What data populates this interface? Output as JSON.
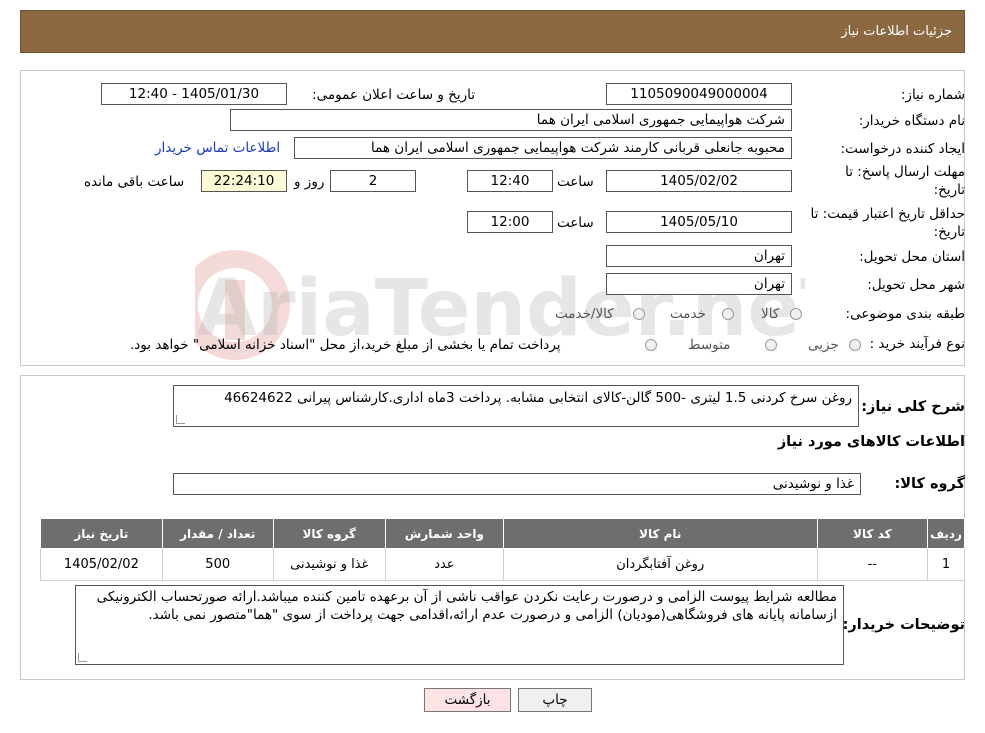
{
  "header": {
    "title": "جزئیات اطلاعات نیاز"
  },
  "form": {
    "need_number_label": "شماره نیاز:",
    "need_number": "1105090049000004",
    "announce_label": "تاریخ و ساعت اعلان عمومی:",
    "announce_value": "1405/01/30 - 12:40",
    "buyer_org_label": "نام دستگاه خریدار:",
    "buyer_org": "شرکت هواپیمایی جمهوری اسلامی ایران هما",
    "creator_label": "ایجاد کننده درخواست:",
    "creator": "محبوبه جانعلی قربانی کارمند شرکت هواپیمایی جمهوری اسلامی ایران هما",
    "contact_link": "اطلاعات تماس خریدار",
    "deadline_label_1": "مهلت ارسال پاسخ: تا",
    "deadline_label_2": "تاریخ:",
    "deadline_date": "1405/02/02",
    "time_label": "ساعت",
    "deadline_time": "12:40",
    "days_value": "2",
    "days_label": "روز و",
    "remaining_time": "22:24:10",
    "remaining_label": "ساعت باقی مانده",
    "validity_label_1": "حداقل تاریخ اعتبار قیمت: تا",
    "validity_label_2": "تاریخ:",
    "validity_date": "1405/05/10",
    "validity_time": "12:00",
    "province_label": "استان محل تحویل:",
    "province": "تهران",
    "city_label": "شهر محل تحویل:",
    "city": "تهران",
    "category_label": "طبقه بندی موضوعی:",
    "category_options": [
      "کالا",
      "خدمت",
      "کالا/خدمت"
    ],
    "process_label": "نوع فرآیند خرید :",
    "process_options": [
      "جزیی",
      "متوسط"
    ],
    "process_note": "پرداخت تمام یا بخشی از مبلغ خرید،از محل \"اسناد خزانه اسلامی\" خواهد بود."
  },
  "summary": {
    "label": "شرح کلی نیاز:",
    "text": "روغن سرخ کردنی 1.5 لیتری -500 گالن-کالای انتخابی مشابه. پرداخت 3ماه اداری.کارشناس پیرانی 46624622"
  },
  "goods": {
    "section_title": "اطلاعات کالاهای مورد نیاز",
    "group_label": "گروه کالا:",
    "group_value": "غذا و نوشیدنی",
    "columns": [
      "ردیف",
      "کد کالا",
      "نام کالا",
      "واحد شمارش",
      "گروه کالا",
      "تعداد / مقدار",
      "تاریخ نیاز"
    ],
    "rows": [
      [
        "1",
        "--",
        "روغن آفتابگردان",
        "عدد",
        "غذا و نوشیدنی",
        "500",
        "1405/02/02"
      ]
    ]
  },
  "notes": {
    "label": "توضیحات خریدار:",
    "text": "مطالعه شرایط پیوست الزامی و درصورت رعایت نکردن عواقب ناشی از آن برعهده تامین کننده میباشد.ارائه صورتحساب الکترونیکی ازسامانه پایانه های فروشگاهی(مودیان) الزامی و درصورت عدم ارائه،اقدامی جهت پرداخت از سوی \"هما\"متصور نمی باشد."
  },
  "buttons": {
    "print": "چاپ",
    "back": "بازگشت"
  },
  "colors": {
    "header": "#8b6840",
    "link": "#1a39c9",
    "back_button": "#fde3e3",
    "remaining_bg": "#fdfbd6"
  }
}
